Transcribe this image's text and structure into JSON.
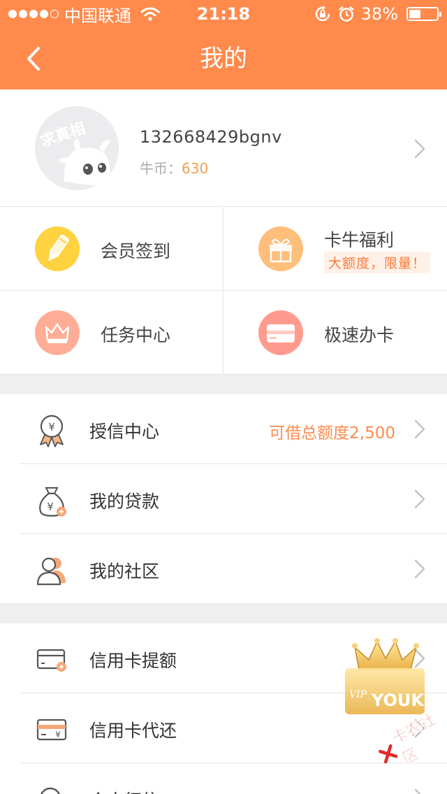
{
  "status_bar": {
    "carrier": "中国联通",
    "time": "21:18",
    "battery": "38%",
    "battery_level": 0.38
  },
  "nav": {
    "title": "我的"
  },
  "profile": {
    "avatar_text": "求真相",
    "username": "132668429bgnv",
    "coins_label": "牛币：",
    "coins_value": "630"
  },
  "quick_actions": [
    {
      "label": "会员签到",
      "icon": "pencil-icon",
      "color": "#ffd23f"
    },
    {
      "label": "卡牛福利",
      "badge": "大额度，限量！",
      "icon": "gift-icon",
      "color": "#ffbe7a"
    },
    {
      "label": "任务中心",
      "icon": "crown-icon",
      "color": "#ffad96"
    },
    {
      "label": "极速办卡",
      "icon": "card-icon",
      "color": "#ff9b8e"
    }
  ],
  "menu_group_1": [
    {
      "label": "授信中心",
      "value": "可借总额度2,500",
      "icon": "medal-icon"
    },
    {
      "label": "我的贷款",
      "value": "",
      "icon": "money-bag-icon"
    },
    {
      "label": "我的社区",
      "value": "",
      "icon": "people-icon"
    }
  ],
  "menu_group_2": [
    {
      "label": "信用卡提额",
      "icon": "card-plus-icon"
    },
    {
      "label": "信用卡代还",
      "icon": "card-yen-icon"
    },
    {
      "label": "个人征信",
      "icon": "search-icon"
    }
  ],
  "overlays": {
    "vip_badge_text": "VIP YOUKU",
    "watermark_text": "卡农社区"
  },
  "colors": {
    "accent": "#ff8a4c",
    "value_orange": "#ff8a4c",
    "background": "#efefef"
  }
}
